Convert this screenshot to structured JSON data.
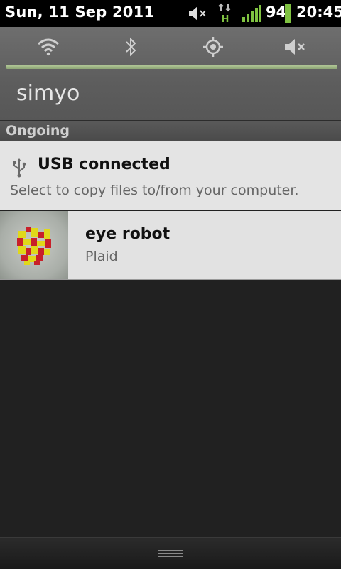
{
  "status_bar": {
    "date": "Sun, 11 Sep 2011",
    "battery_percent": "94",
    "time": "20:45",
    "network_type": "H",
    "icons": [
      "mute-icon",
      "data-arrows-icon",
      "signal-bars-icon",
      "battery-icon"
    ],
    "accent_green": "#7fc241"
  },
  "quick_settings": {
    "toggles": [
      "wifi-icon",
      "bluetooth-icon",
      "gps-icon",
      "mute-icon"
    ],
    "carrier": "simyo"
  },
  "ongoing": {
    "header": "Ongoing"
  },
  "notifications": [
    {
      "title": "USB connected",
      "subtitle": "Select to copy files to/from your computer.",
      "icon": "usb-icon"
    },
    {
      "title": "eye robot",
      "subtitle": "Plaid",
      "icon": "album-art"
    }
  ]
}
